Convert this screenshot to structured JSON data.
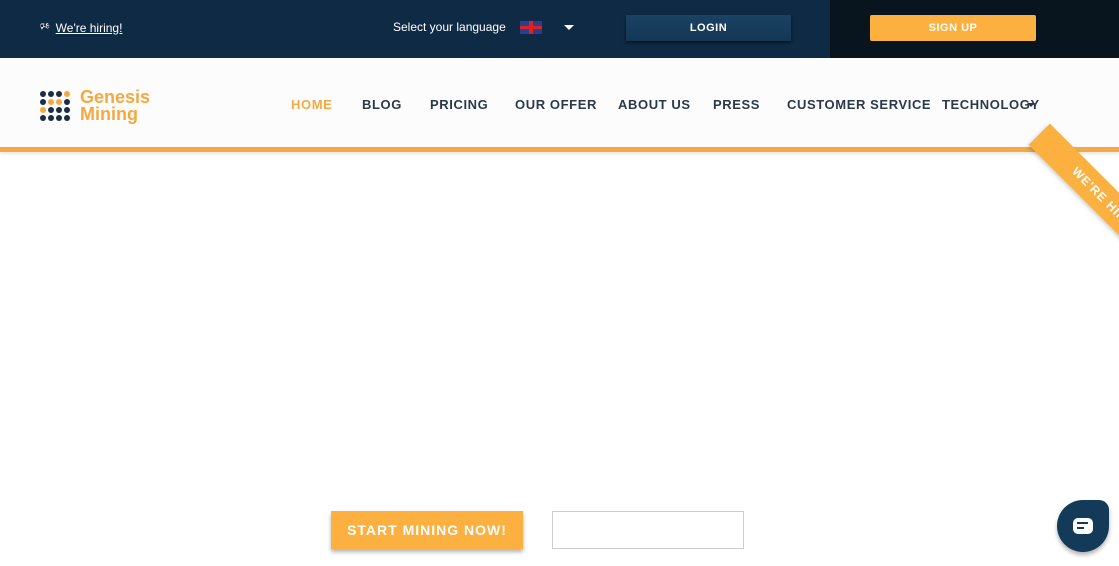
{
  "topbar": {
    "hiring_label": "We're hiring!",
    "hiring_icon": "megaphone-icon",
    "language_label": "Select your language",
    "language_flag": "uk-flag-icon",
    "login": "LOGIN",
    "signup": "SIGN UP"
  },
  "logo": {
    "line1": "Genesis",
    "line2": "Mining"
  },
  "nav": {
    "items": [
      {
        "label": "HOME"
      },
      {
        "label": "BLOG"
      },
      {
        "label": "PRICING"
      },
      {
        "label": "OUR OFFER"
      },
      {
        "label": "ABOUT US"
      },
      {
        "label": "PRESS"
      },
      {
        "label": "CUSTOMER SERVICE"
      },
      {
        "label": "TECHNOLOGY"
      }
    ]
  },
  "ribbon": "WE'RE HIRING!",
  "hero": {
    "start_button": "START MINING NOW!",
    "input_value": ""
  },
  "colors": {
    "accent": "#fbb040",
    "navy": "#0e2a44"
  }
}
